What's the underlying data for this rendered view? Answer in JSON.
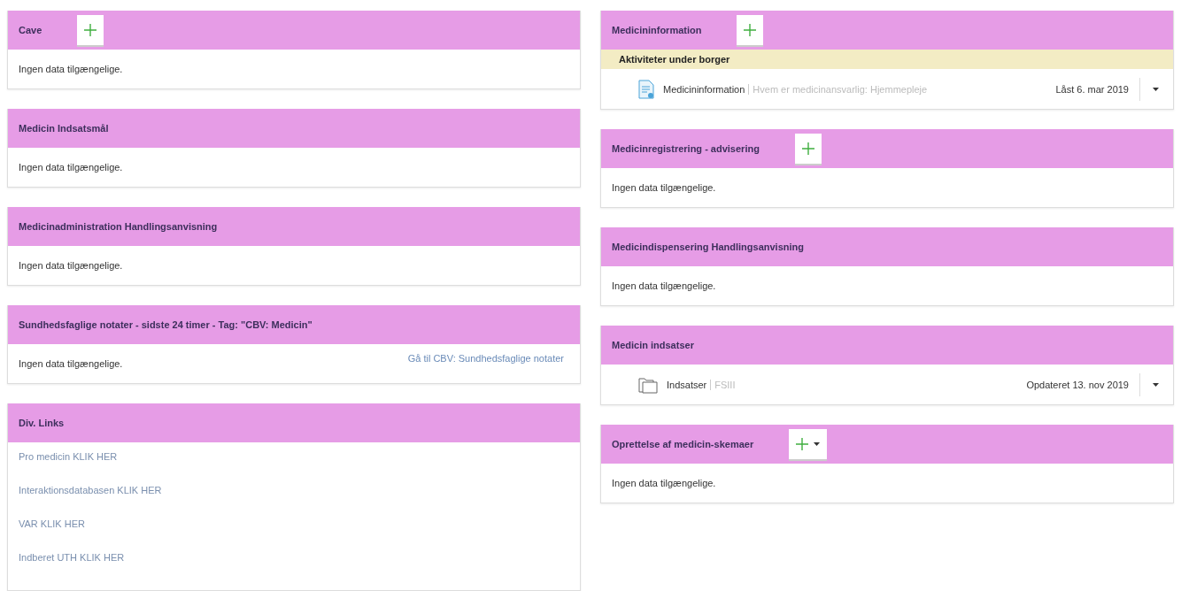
{
  "columns": [
    {
      "panels": [
        {
          "title": "Cave",
          "add_button": true,
          "blocks": [
            {
              "kind": "empty",
              "text": "Ingen data tilgængelige."
            }
          ]
        },
        {
          "title": "Medicin Indsatsmål",
          "blocks": [
            {
              "kind": "empty",
              "text": "Ingen data tilgængelige."
            }
          ]
        },
        {
          "title": "Medicinadministration Handlingsanvisning",
          "blocks": [
            {
              "kind": "empty",
              "text": "Ingen data tilgængelige."
            }
          ]
        },
        {
          "title": "Sundhedsfaglige notater - sidste 24 timer - Tag: \"CBV: Medicin\"",
          "blocks": [
            {
              "kind": "empty",
              "text": "Ingen data tilgængelige.",
              "link": "Gå til CBV: Sundhedsfaglige notater"
            }
          ]
        },
        {
          "title": "Div. Links",
          "blocks": [
            {
              "kind": "links",
              "links": [
                "Pro medicin KLIK HER",
                "Interaktionsdatabasen KLIK HER",
                "VAR KLIK HER",
                "Indberet UTH KLIK HER"
              ]
            }
          ]
        }
      ]
    },
    {
      "panels": [
        {
          "title": "Medicininformation",
          "add_button": true,
          "blocks": [
            {
              "kind": "group",
              "text": "Aktiviteter under borger"
            },
            {
              "kind": "document-item",
              "name": "Medicininformation",
              "detail": "Hvem er medicinansvarlig: Hjemmepleje",
              "status": "Låst 6. mar 2019"
            }
          ]
        },
        {
          "title": "Medicinregistrering - advisering",
          "add_button": true,
          "blocks": [
            {
              "kind": "empty",
              "text": "Ingen data tilgængelige."
            }
          ]
        },
        {
          "title": "Medicindispensering Handlingsanvisning",
          "blocks": [
            {
              "kind": "empty",
              "text": "Ingen data tilgængelige."
            }
          ]
        },
        {
          "title": "Medicin indsatser",
          "blocks": [
            {
              "kind": "folder-item",
              "name": "Indsatser",
              "detail": "FSIII",
              "status": "Opdateret 13. nov 2019"
            }
          ]
        },
        {
          "title": "Oprettelse af medicin-skemaer",
          "add_button": true,
          "add_menu": true,
          "blocks": [
            {
              "kind": "empty",
              "text": "Ingen data tilgængelige."
            }
          ]
        }
      ]
    }
  ]
}
